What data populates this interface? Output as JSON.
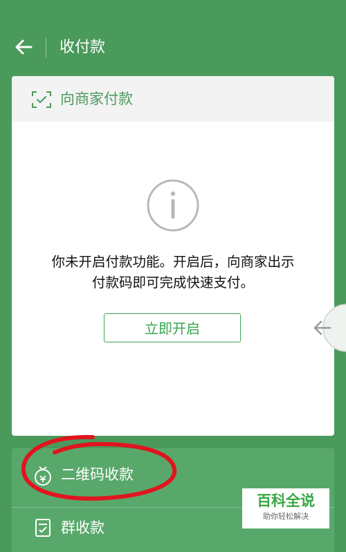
{
  "header": {
    "title": "收付款",
    "back_icon": "arrow-left-icon"
  },
  "card": {
    "header_label": "向商家付款",
    "header_icon": "scan-check-icon",
    "info_icon": "info-circle-icon",
    "message_line1": "你未开启付款功能。开启后，向商家出示",
    "message_line2": "付款码即可完成快速支付。",
    "enable_button": "立即开启"
  },
  "side_nav_icon": "arrow-left-icon",
  "bottom": {
    "qr_label": "二维码收款",
    "qr_icon": "money-bag-icon",
    "group_label": "群收款",
    "group_icon": "checklist-icon"
  },
  "watermark": {
    "main": "百科全说",
    "sub": "助你轻松解决"
  },
  "colors": {
    "bg": "#4a9a5b",
    "accent": "#36a44c",
    "annotation": "#e0151f"
  }
}
